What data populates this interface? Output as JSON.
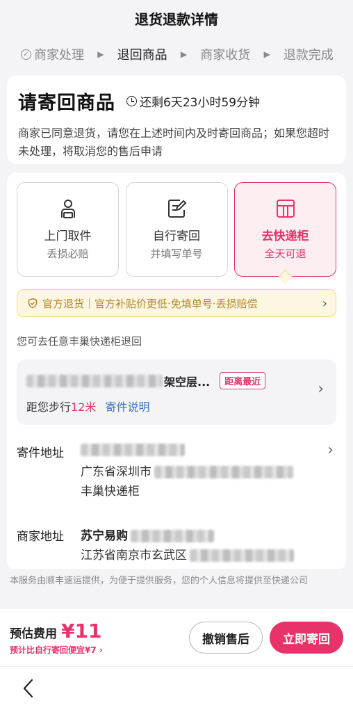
{
  "header": {
    "title": "退货退款详情"
  },
  "steps": [
    {
      "label": "商家处理"
    },
    {
      "label": "退回商品"
    },
    {
      "label": "商家收货"
    },
    {
      "label": "退款完成"
    }
  ],
  "status": {
    "title": "请寄回商品",
    "countdown": "还剩6天23小时59分钟",
    "description": "商家已同意退货，请您在上述时间内及时寄回商品；如果您超时未处理，将取消您的售后申请"
  },
  "options": [
    {
      "title": "上门取件",
      "subtitle": "丢损必赔",
      "icon": "courier-icon"
    },
    {
      "title": "自行寄回",
      "subtitle": "并填写单号",
      "icon": "edit-form-icon"
    },
    {
      "title": "去快递柜",
      "subtitle": "全天可退",
      "icon": "locker-icon"
    }
  ],
  "banner": {
    "text": "官方退货｜官方补贴价更低·免填单号·丢损赔偿"
  },
  "hint": "您可去任意丰巢快递柜退回",
  "locker": {
    "name_suffix": "架空层...",
    "tag": "距离最近",
    "walk_prefix": "距您步行",
    "distance": "12米",
    "link": "寄件说明"
  },
  "sender": {
    "label": "寄件地址",
    "province": "广东省深圳市",
    "locker_type": "丰巢快递柜"
  },
  "merchant": {
    "label": "商家地址",
    "name": "苏宁易购",
    "address": "江苏省南京市玄武区"
  },
  "notice": "本服务由顺丰速运提供，为便于提供服务，您的个人信息将提供至快递公司",
  "footer": {
    "fee_label": "预估费用",
    "fee_amount": "¥11",
    "compare": "预计比自行寄回便宜¥7",
    "cancel_label": "撤销售后",
    "send_label": "立即寄回"
  },
  "colors": {
    "accent": "#e8326a",
    "banner_text": "#b3862a",
    "link": "#3a6fc4"
  }
}
